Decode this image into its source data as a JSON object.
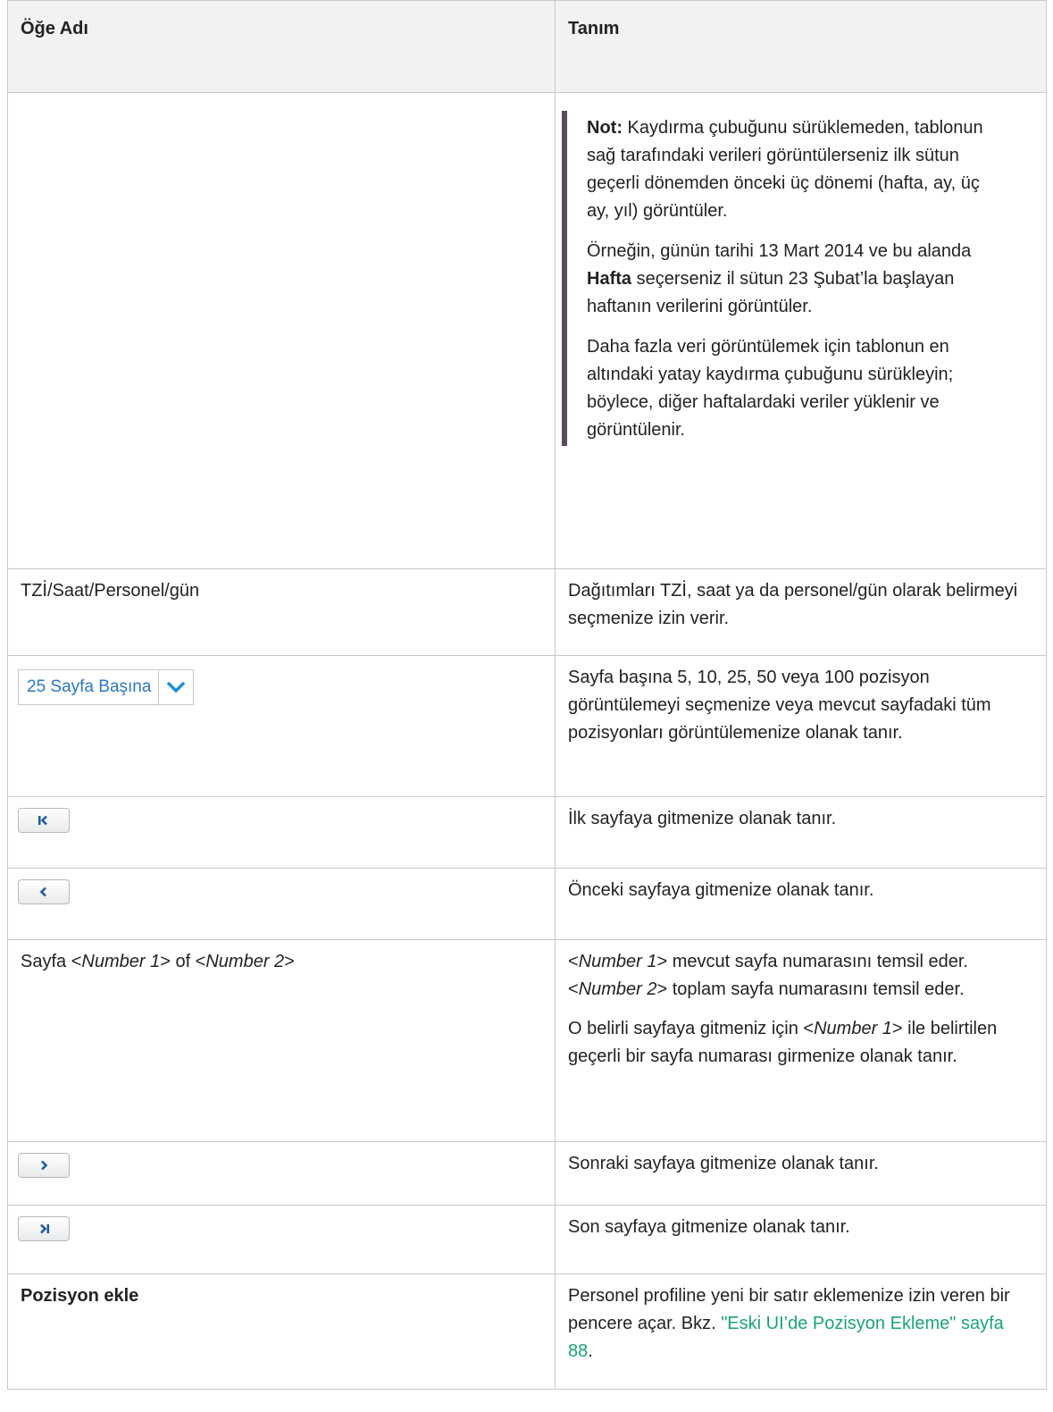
{
  "header": {
    "col1": "Öğe Adı",
    "col2": "Tanım"
  },
  "note_row": {
    "label": "Not:",
    "p1": " Kaydırma çubuğunu sürüklemeden, tablonun sağ tarafındaki verileri görüntülerseniz ilk sütun geçerli dönemden önceki üç dönemi (hafta, ay, üç ay, yıl) görüntüler.",
    "p2_a": "Örneğin, günün tarihi 13 Mart 2014 ve bu alanda ",
    "p2_bold": "Hafta",
    "p2_b": " seçerseniz il sütun 23 Şubat’la başlayan haftanın verilerini görüntüler.",
    "p3": "Daha fazla veri görüntülemek için tablonun en altındaki yatay kaydırma çubuğunu sürükleyin; böylece, diğer haftalardaki veriler yüklenir ve görüntülenir."
  },
  "tzi_row": {
    "name": "TZİ/Saat/Personel/gün",
    "desc": "Dağıtımları TZİ, saat ya da personel/gün olarak belirmeyi seçmenize izin verir."
  },
  "perpage_row": {
    "control_label": "25 Sayfa Başına",
    "icon": "chevron-down-icon",
    "desc": "Sayfa başına 5, 10, 25, 50 veya 100 pozisyon görüntülemeyi seçmenize veya mevcut sayfadaki tüm pozisyonları görüntülemenize olanak tanır."
  },
  "first_row": {
    "icon": "first-page-icon",
    "desc": "İlk sayfaya gitmenize olanak tanır."
  },
  "prev_row": {
    "icon": "previous-page-icon",
    "desc": "Önceki sayfaya gitmenize olanak tanır."
  },
  "pageof_row": {
    "name_a": "Sayfa <",
    "name_num1": "Number 1",
    "name_b": "> of <",
    "name_num2": "Number 2",
    "name_c": ">",
    "d1_a": "<",
    "d1_num1": "Number 1",
    "d1_b": "> mevcut sayfa numarasını temsil eder. <",
    "d1_num2": "Number 2",
    "d1_c": "> toplam sayfa numarasını temsil eder.",
    "d2_a": "O belirli sayfaya gitmeniz için <",
    "d2_num1": "Number 1",
    "d2_b": "> ile belirtilen geçerli bir sayfa numarası girmenize olanak tanır."
  },
  "next_row": {
    "icon": "next-page-icon",
    "desc": "Sonraki sayfaya gitmenize olanak tanır."
  },
  "last_row": {
    "icon": "last-page-icon",
    "desc": "Son sayfaya gitmenize olanak tanır."
  },
  "add_row": {
    "name": "Pozisyon ekle",
    "desc_a": "Personel profiline yeni bir satır eklemenize izin veren bir pencere açar. Bkz. ",
    "link": "\"Eski UI’de Pozisyon Ekleme\" sayfa 88",
    "desc_b": "."
  },
  "colors": {
    "link": "#1aa37a",
    "note_bar": "#5c4a60",
    "header_bg": "#f2f2f2",
    "control_text": "#2a78c6",
    "chevron": "#1d8fd6"
  }
}
